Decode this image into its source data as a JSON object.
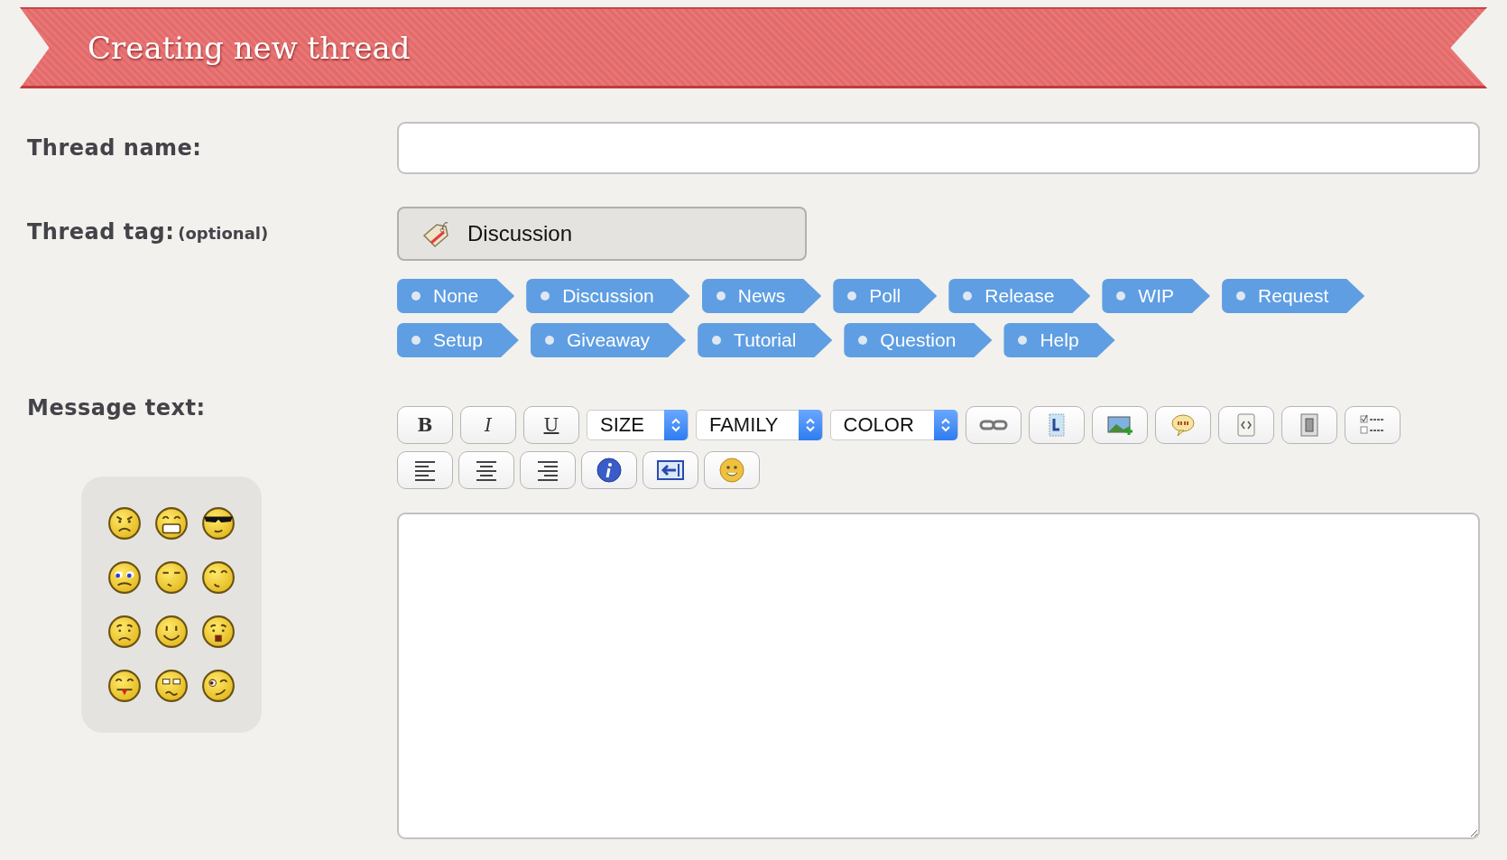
{
  "header": {
    "title": "Creating new thread"
  },
  "thread_name": {
    "label": "Thread name:"
  },
  "thread_tag": {
    "label": "Thread tag:",
    "hint": "(optional)",
    "value": "Discussion"
  },
  "tags": [
    [
      "None",
      "Discussion",
      "News",
      "Poll",
      "Release",
      "WIP",
      "Request"
    ],
    [
      "Setup",
      "Giveaway",
      "Tutorial",
      "Question",
      "Help"
    ]
  ],
  "message": {
    "label": "Message text:"
  },
  "toolbar": [
    [
      {
        "kind": "bold",
        "label": "B"
      },
      {
        "kind": "italic",
        "label": "I"
      },
      {
        "kind": "underline",
        "label": "U"
      },
      {
        "kind": "select",
        "label": "SIZE"
      },
      {
        "kind": "select",
        "label": "FAMILY"
      },
      {
        "kind": "select",
        "label": "COLOR"
      },
      {
        "kind": "icon"
      },
      {
        "kind": "icon"
      },
      {
        "kind": "icon"
      },
      {
        "kind": "icon"
      },
      {
        "kind": "icon"
      },
      {
        "kind": "icon"
      },
      {
        "kind": "icon"
      }
    ],
    [
      {
        "kind": "icon"
      },
      {
        "kind": "icon"
      },
      {
        "kind": "icon"
      },
      {
        "kind": "icon"
      },
      {
        "kind": "icon"
      },
      {
        "kind": "icon"
      }
    ]
  ]
}
